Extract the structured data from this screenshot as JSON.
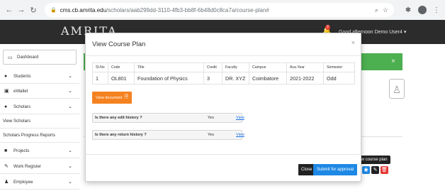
{
  "browser": {
    "host": "cms.cb.amrita.edu",
    "path": "/scholars/aab299dd-3110-4fb3-bb8f-6b48d0c8ca7a/course-plan#"
  },
  "header": {
    "brand": "AMRITA",
    "notification_count": "2",
    "greeting": "Good afternoon Demo User4 ▾"
  },
  "sidebar": {
    "items": [
      {
        "label": "Dashboard",
        "icon": "monitor-icon"
      },
      {
        "label": "Students",
        "icon": "user-icon"
      },
      {
        "label": "eWallet",
        "icon": "wallet-icon"
      },
      {
        "label": "Scholars",
        "icon": "users-icon"
      },
      {
        "label": "View Scholars",
        "icon": ""
      },
      {
        "label": "Scholars Progress Reports",
        "icon": ""
      },
      {
        "label": "Projects",
        "icon": "folder-icon"
      },
      {
        "label": "Work Register",
        "icon": "book-icon"
      },
      {
        "label": "Employee",
        "icon": "employee-icon"
      }
    ]
  },
  "modal": {
    "title": "View Course Plan",
    "close_symbol": "×",
    "table": {
      "headers": [
        "Sl.No",
        "Code",
        "Title",
        "Credit",
        "Faculty",
        "Campus",
        "Aca.Year",
        "Semester"
      ],
      "rows": [
        [
          "1",
          "OL801",
          "Foundation of Physics",
          "3",
          "DR. XYZ",
          "Coimbatore",
          "2021-2022",
          "Odd"
        ]
      ]
    },
    "view_document_label": "View document",
    "edit_history": {
      "question": "Is there any edit history ?",
      "answer": "Yes",
      "link": "View"
    },
    "return_history": {
      "question": "Is there any return history ?",
      "answer": "Yes",
      "link": "View"
    },
    "close_button": "Close",
    "submit_button": "Submit for approval"
  },
  "tooltip": "View course plan",
  "colors": {
    "header_bg": "#2c2c2c",
    "success_bar": "#4caf50",
    "primary": "#1e88e5",
    "orange": "#f58220",
    "danger": "#e53935"
  }
}
